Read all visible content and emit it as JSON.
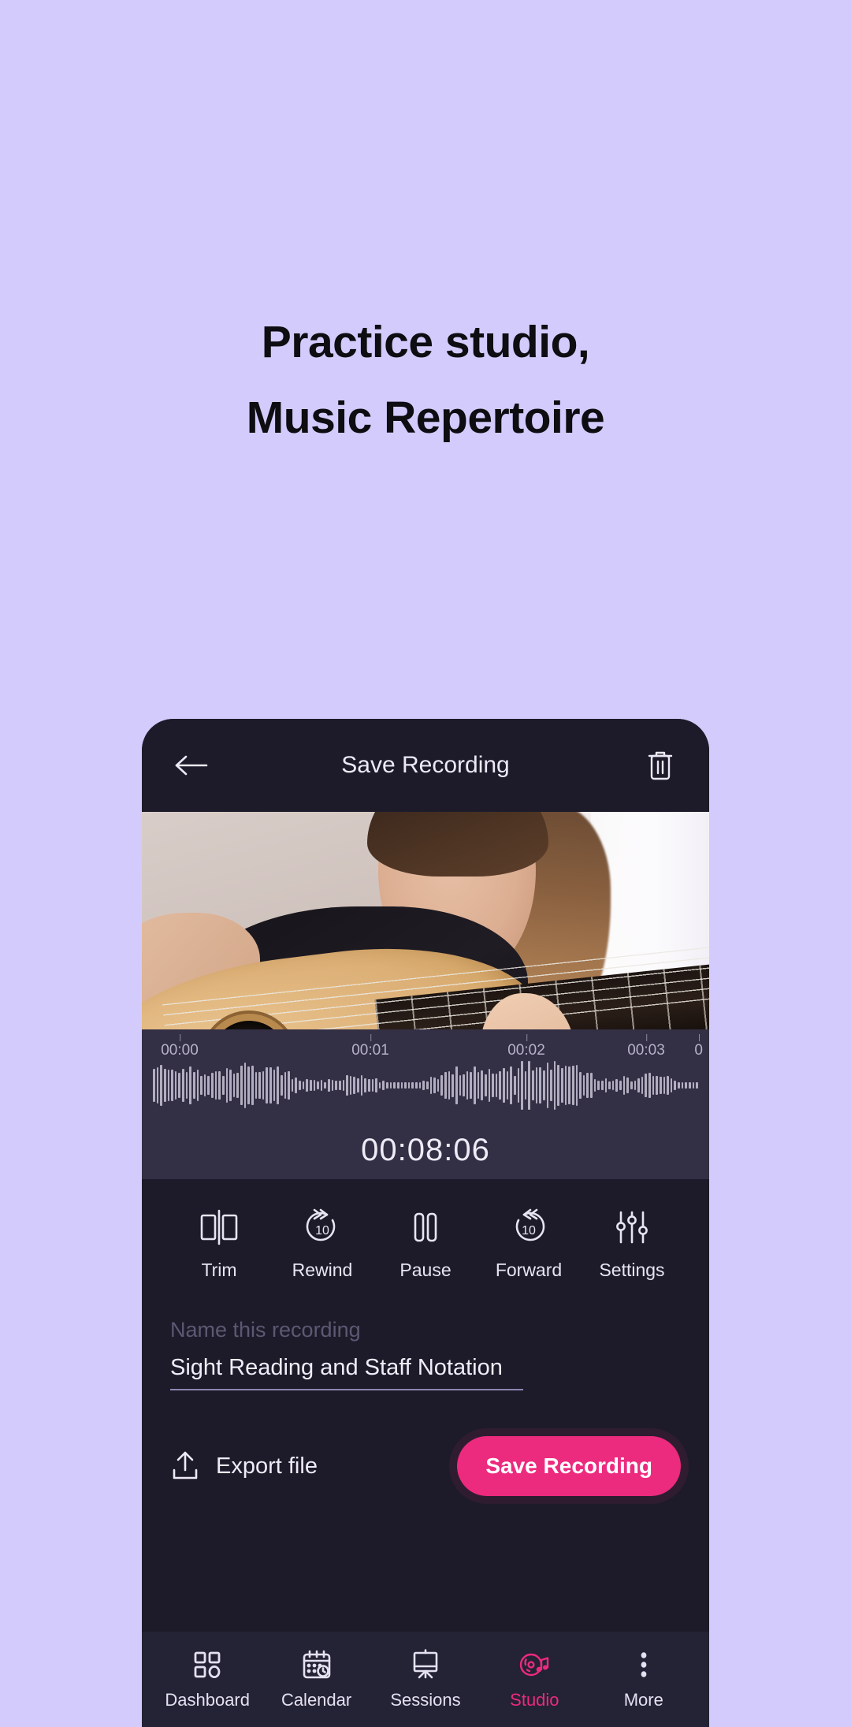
{
  "page": {
    "background_color": "#d3cbfb",
    "headline_line1": "Practice studio,",
    "headline_line2": "Music Repertoire"
  },
  "theme": {
    "card_bg": "#1d1b2a",
    "panel_bg": "#332f45",
    "nav_bg": "#242235",
    "accent": "#ec2a7e",
    "text_primary": "#efedf8",
    "text_muted": "#5d5872"
  },
  "app": {
    "header": {
      "title": "Save Recording",
      "back_icon": "arrow-left-icon",
      "delete_icon": "trash-icon"
    },
    "preview": {
      "media_type": "video-frame",
      "description": "woman playing acoustic guitar"
    },
    "timeline": {
      "ticks": [
        "00:00",
        "00:01",
        "00:02",
        "00:03",
        "0"
      ],
      "elapsed": "00:08:06"
    },
    "controls": [
      {
        "label": "Trim",
        "icon": "trim-icon"
      },
      {
        "label": "Rewind",
        "icon": "rewind-10-icon"
      },
      {
        "label": "Pause",
        "icon": "pause-icon"
      },
      {
        "label": "Forward",
        "icon": "forward-10-icon"
      },
      {
        "label": "Settings",
        "icon": "sliders-icon"
      }
    ],
    "name_field": {
      "label": "Name this recording",
      "value": "Sight Reading and Staff Notation",
      "placeholder": "Name this recording"
    },
    "actions": {
      "export_label": "Export file",
      "export_icon": "upload-icon",
      "save_label": "Save Recording"
    },
    "bottom_nav": [
      {
        "label": "Dashboard",
        "icon": "grid-icon",
        "active": false
      },
      {
        "label": "Calendar",
        "icon": "calendar-clock-icon",
        "active": false
      },
      {
        "label": "Sessions",
        "icon": "easel-icon",
        "active": false
      },
      {
        "label": "Studio",
        "icon": "vinyl-music-icon",
        "active": true
      },
      {
        "label": "More",
        "icon": "dots-vertical-icon",
        "active": false
      }
    ]
  }
}
